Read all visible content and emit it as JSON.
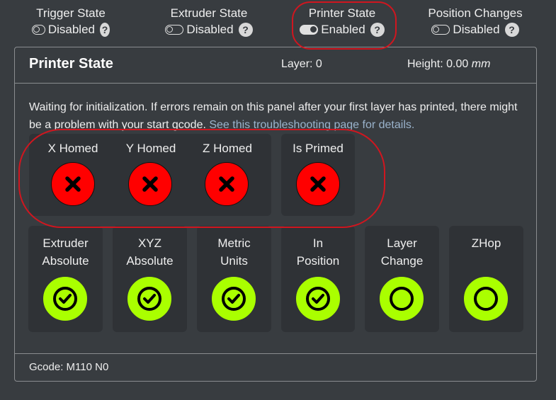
{
  "toggles": [
    {
      "label": "Trigger State",
      "state": "Disabled",
      "on": false
    },
    {
      "label": "Extruder State",
      "state": "Disabled",
      "on": false
    },
    {
      "label": "Printer State",
      "state": "Enabled",
      "on": true
    },
    {
      "label": "Position Changes",
      "state": "Disabled",
      "on": false
    }
  ],
  "help_glyph": "?",
  "panel": {
    "title": "Printer State",
    "layer": "Layer: 0",
    "height_label": "Height: 0.00",
    "height_unit": "mm",
    "message": "Waiting for initialization. If errors remain on this panel after your first layer has printed, there might be a problem with your start gcode.",
    "message_link": "See this troubleshooting page for details.",
    "homed_items": [
      {
        "label": "X Homed",
        "status": "error"
      },
      {
        "label": "Y Homed",
        "status": "error"
      },
      {
        "label": "Z Homed",
        "status": "error"
      }
    ],
    "primed_item": {
      "label": "Is Primed",
      "status": "error"
    },
    "state_items": [
      {
        "line1": "Extruder",
        "line2": "Absolute",
        "status": "check"
      },
      {
        "line1": "XYZ",
        "line2": "Absolute",
        "status": "check"
      },
      {
        "line1": "Metric",
        "line2": "Units",
        "status": "check"
      },
      {
        "line1": "In",
        "line2": "Position",
        "status": "check"
      },
      {
        "line1": "Layer",
        "line2": "Change",
        "status": "open"
      },
      {
        "line1": "ZHop",
        "line2": "",
        "status": "open"
      }
    ],
    "gcode": "Gcode: M110 N0"
  },
  "colors": {
    "error": "#ff0000",
    "ok": "#aaff00",
    "annotation": "#d0161f",
    "link": "#9ab3cc"
  }
}
